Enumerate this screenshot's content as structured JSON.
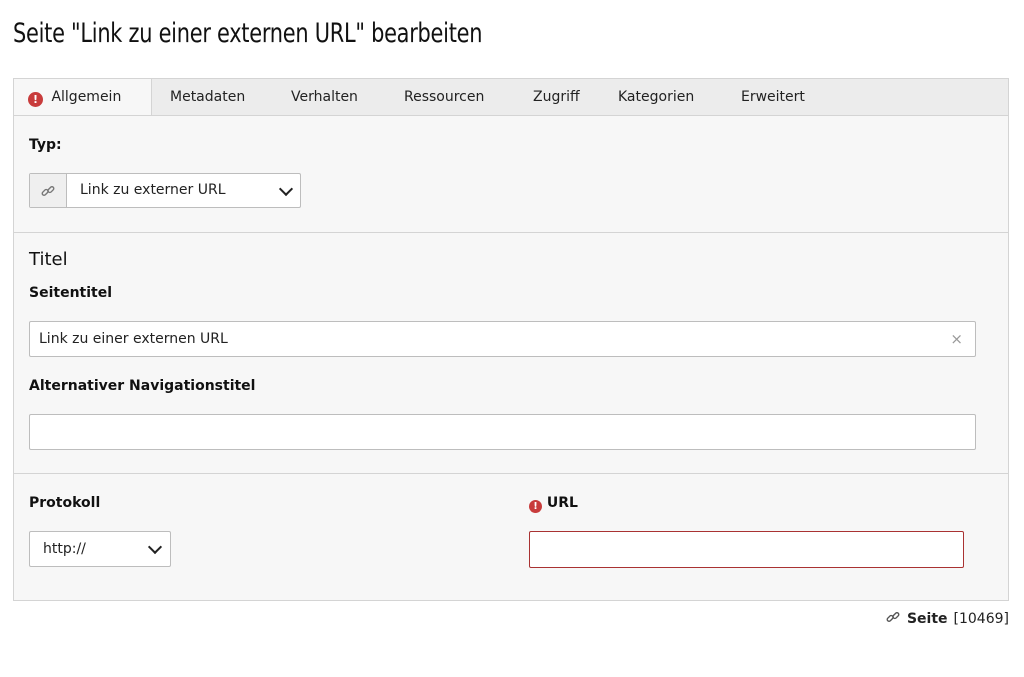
{
  "header": {
    "title": "Seite \"Link zu einer externen URL\" bearbeiten"
  },
  "tabs": [
    {
      "label": "Allgemein",
      "active": true,
      "has_error": true
    },
    {
      "label": "Metadaten"
    },
    {
      "label": "Verhalten"
    },
    {
      "label": "Ressourcen"
    },
    {
      "label": "Zugriff"
    },
    {
      "label": "Kategorien"
    },
    {
      "label": "Erweitert"
    }
  ],
  "type_field": {
    "label": "Typ:",
    "value": "Link zu externer URL",
    "icon": "link-icon"
  },
  "title_section": {
    "heading": "Titel",
    "page_title_label": "Seitentitel",
    "page_title_value": "Link zu einer externen URL",
    "clear_glyph": "×",
    "nav_title_label": "Alternativer Navigationstitel",
    "nav_title_value": ""
  },
  "url_section": {
    "protocol_label": "Protokoll",
    "protocol_value": "http://",
    "url_label": "URL",
    "url_value": "",
    "url_error": true
  },
  "footer": {
    "type": "Seite",
    "id": "[10469]",
    "icon": "link-icon"
  },
  "colors": {
    "error": "#c83c3c",
    "error_border": "#a93232",
    "panel_bg": "#f7f7f7",
    "tab_bg": "#ececec"
  }
}
